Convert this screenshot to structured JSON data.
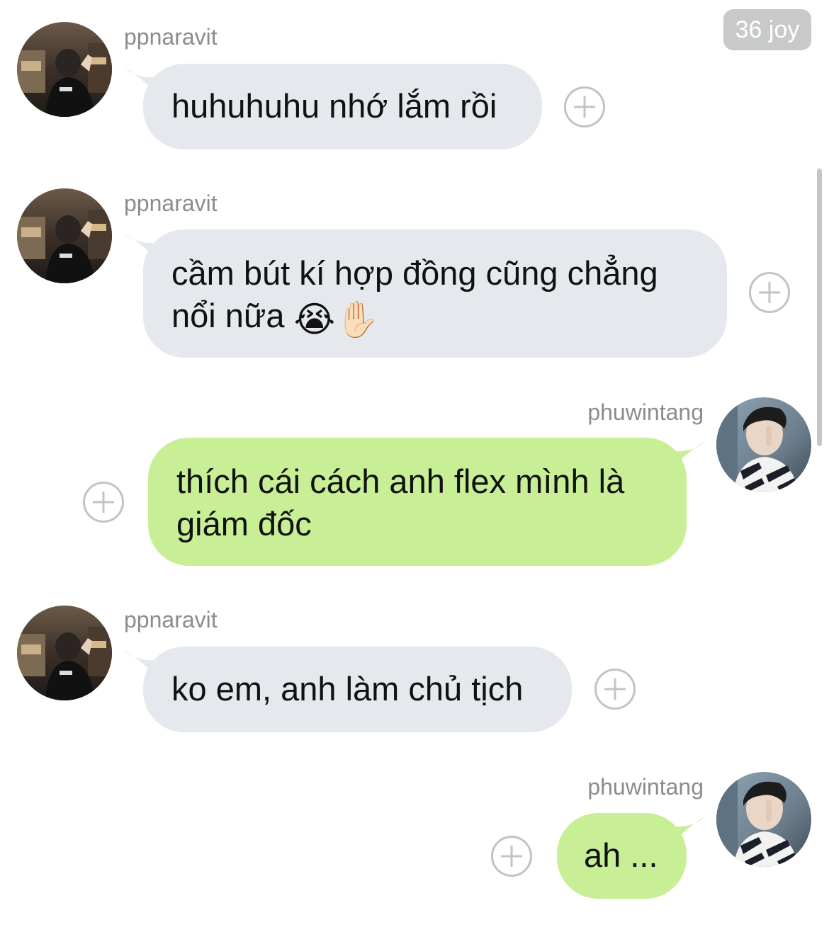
{
  "reaction_badge": "36 joy",
  "users": {
    "left": "ppnaravit",
    "right": "phuwintang"
  },
  "messages": [
    {
      "sender": "ppnaravit",
      "side": "left",
      "lines": [
        "huhuhuhu nhớ lắm rồi"
      ]
    },
    {
      "sender": "ppnaravit",
      "side": "left",
      "lines": [
        "cầm bút kí hợp đồng cũng chẳng",
        "nổi nữa"
      ],
      "emoji": "😭✋🏻"
    },
    {
      "sender": "phuwintang",
      "side": "right",
      "lines": [
        "thích cái cách anh flex mình là",
        "giám đốc"
      ]
    },
    {
      "sender": "ppnaravit",
      "side": "left",
      "lines": [
        "ko em, anh làm chủ tịch"
      ]
    },
    {
      "sender": "phuwintang",
      "side": "right",
      "lines": [
        "ah ..."
      ]
    }
  ],
  "icons": {
    "add_reaction": "plus-circle-icon",
    "avatar_left": "avatar-photo",
    "avatar_right": "avatar-photo"
  },
  "colors": {
    "incoming_bubble": "#e5e8ec",
    "outgoing_bubble": "#c8ee96",
    "badge": "#c8c9cb"
  }
}
